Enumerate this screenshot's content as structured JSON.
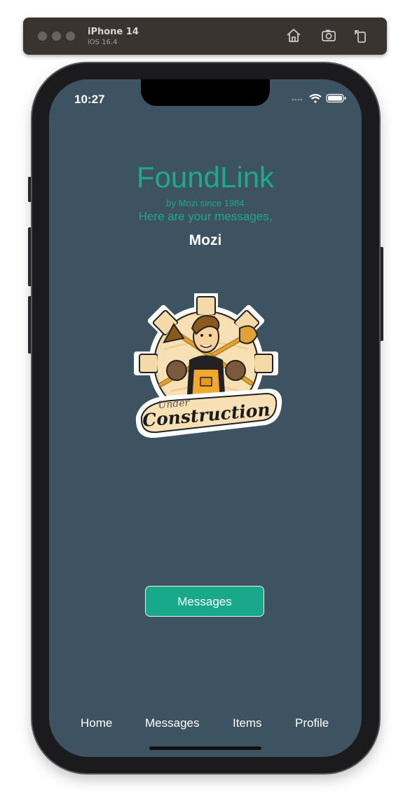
{
  "simulator": {
    "device_name": "iPhone 14",
    "os_version": "iOS 16.4",
    "icons": [
      "home-icon",
      "screenshot-icon",
      "rotate-icon"
    ]
  },
  "status_bar": {
    "time": "10:27",
    "icons": [
      "signal-dots-icon",
      "wifi-icon",
      "battery-icon"
    ]
  },
  "header": {
    "title": "FoundLink",
    "byline": "by Mozi since 1984",
    "greeting": "Here are your messages,",
    "username": "Mozi"
  },
  "badge": {
    "small_text": "Under",
    "big_text": "Construction",
    "icon": "under-construction-badge"
  },
  "primary_button": {
    "label": "Messages"
  },
  "tabbar": {
    "items": [
      {
        "label": "Home"
      },
      {
        "label": "Messages"
      },
      {
        "label": "Items"
      },
      {
        "label": "Profile"
      }
    ]
  },
  "colors": {
    "background": "#3d5361",
    "accent": "#1fa88b",
    "button": "#1aa88a",
    "text": "#ffffff"
  }
}
